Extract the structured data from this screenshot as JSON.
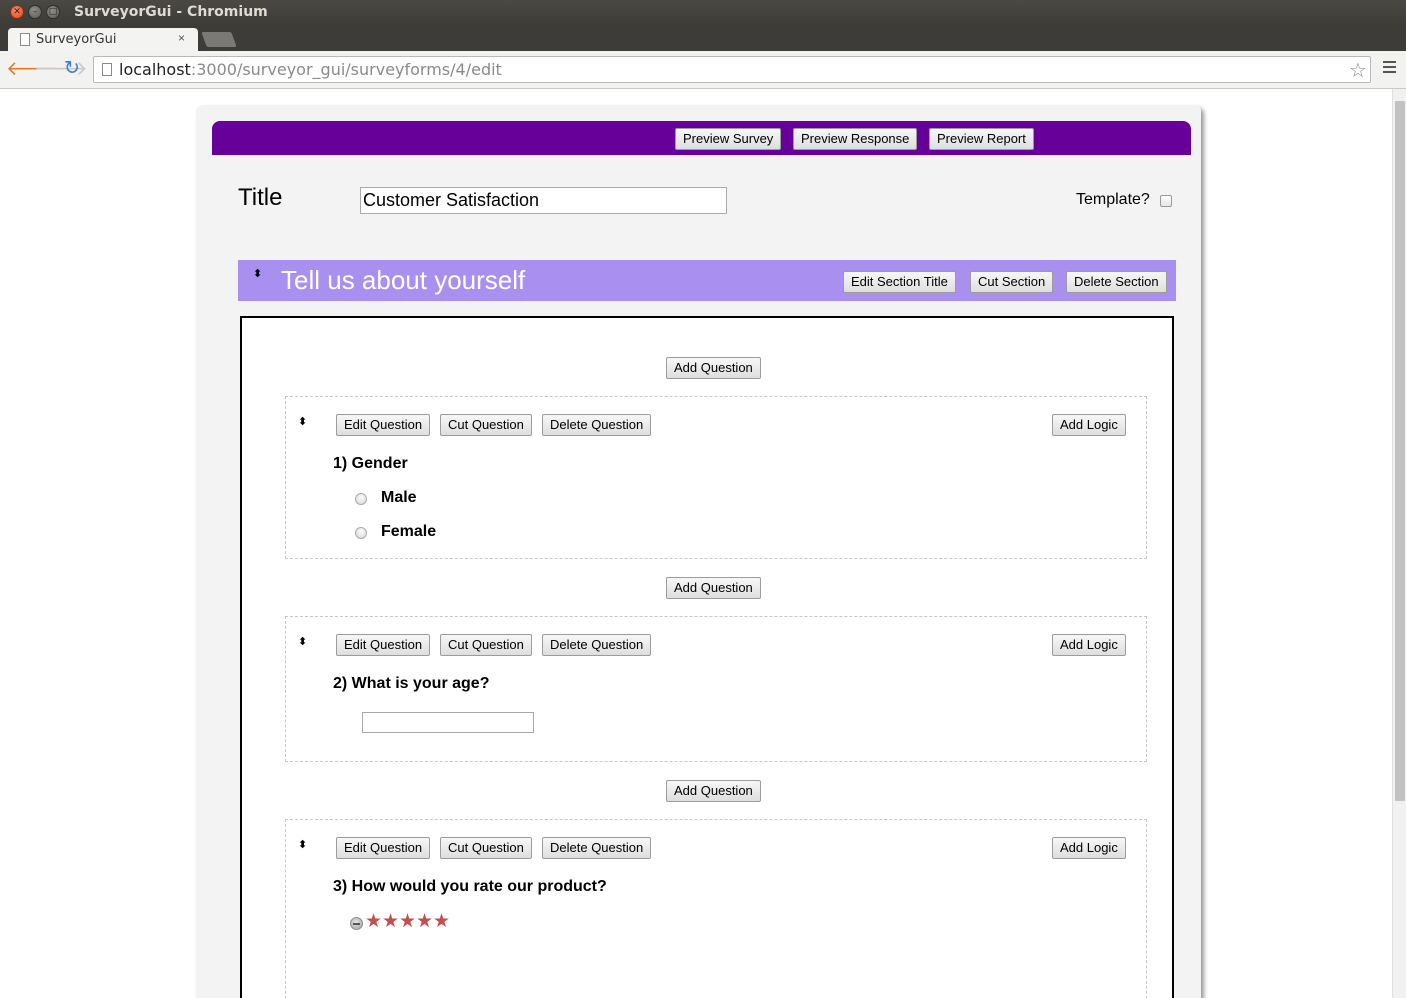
{
  "browser": {
    "window_title": "SurveyorGui - Chromium",
    "tab_title": "SurveyorGui",
    "tab_close": "×",
    "url_host": "localhost",
    "url_path": ":3000/surveyor_gui/surveyforms/4/edit"
  },
  "header_buttons": {
    "preview_survey": "Preview Survey",
    "preview_response": "Preview Response",
    "preview_report": "Preview Report"
  },
  "survey": {
    "title_label": "Title",
    "title_value": "Customer Satisfaction",
    "template_label": "Template?",
    "template_checked": false
  },
  "section": {
    "title": "Tell us about yourself",
    "edit_title_label": "Edit Section Title",
    "cut_label": "Cut Section",
    "delete_label": "Delete Section",
    "drag_glyph": "⬍"
  },
  "question_actions": {
    "add_question": "Add Question",
    "edit_question": "Edit Question",
    "cut_question": "Cut Question",
    "delete_question": "Delete Question",
    "add_logic": "Add Logic"
  },
  "questions": [
    {
      "text": "1) Gender",
      "type": "radio",
      "options": [
        "Male",
        "Female"
      ]
    },
    {
      "text": "2) What is your age?",
      "type": "text"
    },
    {
      "text": "3) How would you rate our product?",
      "type": "star-rating",
      "stars": 5,
      "icon_color": "#c0504d"
    }
  ],
  "colors": {
    "header_bar": "#660099",
    "section_bar": "#a98ff0"
  }
}
